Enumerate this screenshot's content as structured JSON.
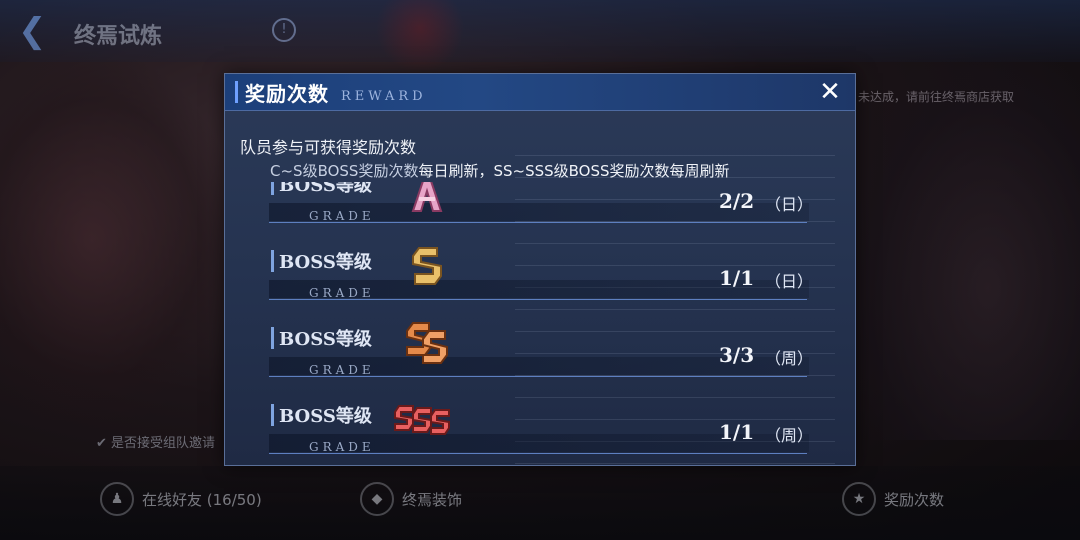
{
  "background": {
    "title": "终焉试炼",
    "notice": "未达成，请前往终焉商店获取",
    "checkbox_label": "是否接受组队邀请",
    "bottom_buttons": [
      {
        "label": "在线好友 (16/50)",
        "icon": "friends-icon"
      },
      {
        "label": "终焉装饰",
        "icon": "decoration-icon"
      },
      {
        "label": "奖励次数",
        "icon": "reward-icon"
      }
    ]
  },
  "modal": {
    "title": "奖励次数",
    "subtitle": "REWARD",
    "close_label": "✕",
    "description": "队员参与可获得奖励次数",
    "refresh_note": {
      "part1": "C~S级BOSS奖励次数",
      "part2": "每日刷新，SS~SSS级BOSS奖励次数",
      "part3": "每周刷新"
    },
    "rows": [
      {
        "label": "BOSS等级",
        "grade_text": "GRADE",
        "grade": "A",
        "count": "2/2",
        "period": "（日）",
        "color": "#e7a4c7"
      },
      {
        "label": "BOSS等级",
        "grade_text": "GRADE",
        "grade": "S",
        "count": "1/1",
        "period": "（日）",
        "color": "#e9c06a"
      },
      {
        "label": "BOSS等级",
        "grade_text": "GRADE",
        "grade": "SS",
        "count": "3/3",
        "period": "（周）",
        "color": "#e58a4a"
      },
      {
        "label": "BOSS等级",
        "grade_text": "GRADE",
        "grade": "SSS",
        "count": "1/1",
        "period": "（周）",
        "color": "#e86060"
      }
    ]
  }
}
